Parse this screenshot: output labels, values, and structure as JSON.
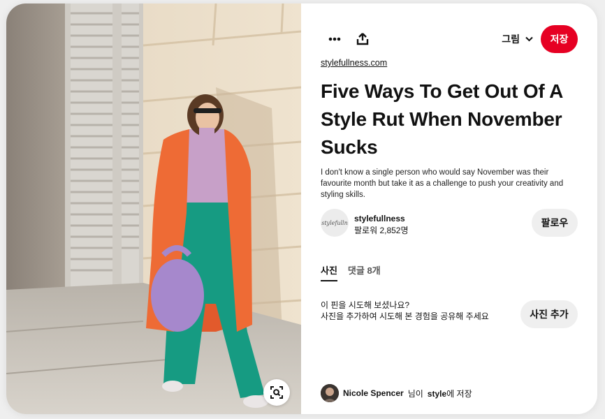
{
  "pin": {
    "image_description": "Woman in orange coat, lilac turtleneck and green trousers leaning on a wall",
    "lens_icon": "visual-search-icon"
  },
  "toolbar": {
    "more_icon": "more-dots-icon",
    "share_icon": "share-upload-icon",
    "board_label": "그림",
    "board_icon": "chevron-down-icon",
    "save_label": "저장",
    "accent": "#e60023"
  },
  "source": {
    "link_text": "stylefullness.com"
  },
  "title": "Five Ways To Get Out Of A Style Rut When November Sucks",
  "description": "I don't know a single person who would say November was their favourite month but take it as a challenge to push your creativity and styling skills.",
  "author": {
    "name": "stylefullness",
    "followers": "팔로워 2,852명",
    "avatar_text": "stylefulln",
    "follow_label": "팔로우"
  },
  "tabs": [
    {
      "label": "사진",
      "active": true
    },
    {
      "label": "댓글 8개",
      "active": false
    }
  ],
  "try_it": {
    "question": "이 핀을 시도해 보셨나요?",
    "hint": "사진을 추가하여 시도해 본 경험을 공유해 주세요",
    "button_label": "사진 추가"
  },
  "saved_by": {
    "user": "Nicole Spencer",
    "connector": "님이",
    "board": "style",
    "suffix": "에 저장"
  }
}
